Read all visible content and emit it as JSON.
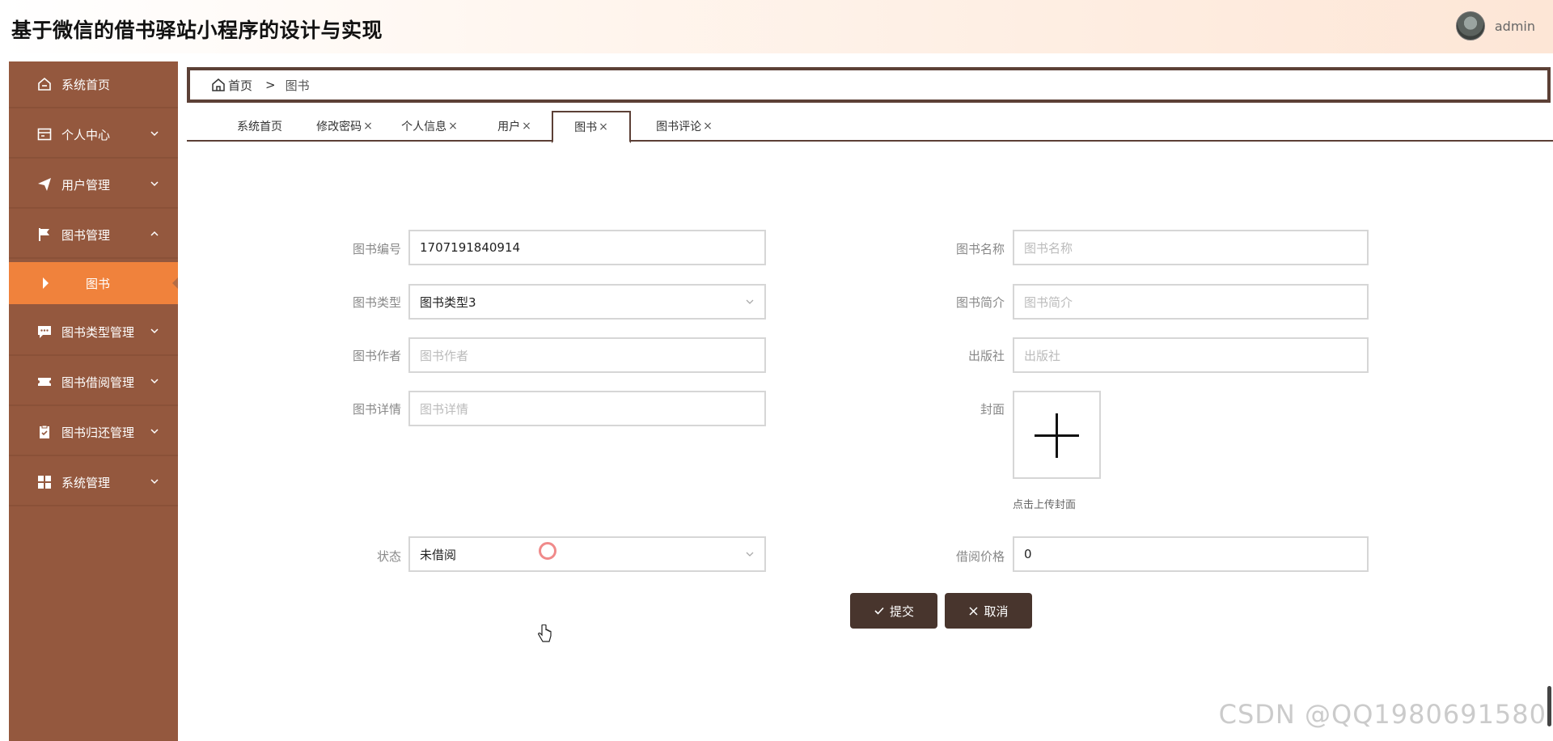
{
  "header": {
    "title": "基于微信的借书驿站小程序的设计与实现",
    "username": "admin"
  },
  "sidebar": {
    "items": [
      {
        "label": "系统首页",
        "icon": "home-icon"
      },
      {
        "label": "个人中心",
        "icon": "card-icon"
      },
      {
        "label": "用户管理",
        "icon": "paper-plane-icon"
      },
      {
        "label": "图书管理",
        "icon": "flag-icon"
      },
      {
        "label": "图书类型管理",
        "icon": "chat-icon"
      },
      {
        "label": "图书借阅管理",
        "icon": "ticket-icon"
      },
      {
        "label": "图书归还管理",
        "icon": "clipboard-icon"
      },
      {
        "label": "系统管理",
        "icon": "grid-icon"
      }
    ],
    "submenu": {
      "label": "图书"
    }
  },
  "breadcrumb": {
    "home": "首页",
    "separator": ">",
    "current": "图书"
  },
  "tabs": [
    {
      "label": "系统首页",
      "closable": false
    },
    {
      "label": "修改密码",
      "closable": true
    },
    {
      "label": "个人信息",
      "closable": true
    },
    {
      "label": "用户",
      "closable": true
    },
    {
      "label": "图书",
      "closable": true,
      "active": true
    },
    {
      "label": "图书评论",
      "closable": true
    }
  ],
  "tab_close": "×",
  "form": {
    "book_no": {
      "label": "图书编号",
      "value": "1707191840914"
    },
    "book_name": {
      "label": "图书名称",
      "placeholder": "图书名称"
    },
    "book_type": {
      "label": "图书类型",
      "value": "图书类型3"
    },
    "book_intro": {
      "label": "图书简介",
      "placeholder": "图书简介"
    },
    "author": {
      "label": "图书作者",
      "placeholder": "图书作者"
    },
    "publisher": {
      "label": "出版社",
      "placeholder": "出版社"
    },
    "detail": {
      "label": "图书详情",
      "placeholder": "图书详情"
    },
    "cover": {
      "label": "封面",
      "hint": "点击上传封面"
    },
    "status": {
      "label": "状态",
      "value": "未借阅"
    },
    "price": {
      "label": "借阅价格",
      "value": "0"
    }
  },
  "buttons": {
    "submit": "提交",
    "cancel": "取消"
  },
  "watermark": "CSDN @QQ1980691580",
  "colors": {
    "sidebar": "#94583e",
    "submenu_active": "#f0823c",
    "primary_button": "#48352d",
    "border_accent": "#5c4036"
  }
}
